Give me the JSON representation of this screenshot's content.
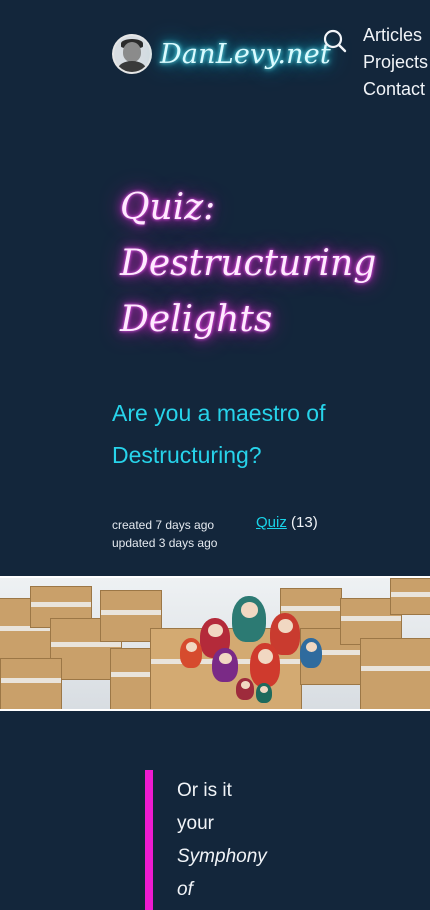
{
  "header": {
    "logo": "DanLevy.net",
    "nav": [
      "Articles",
      "Projects",
      "Contact"
    ]
  },
  "article": {
    "title": "Quiz: Destructuring Delights",
    "subtitle": "Are you a maestro of Destructuring?",
    "created": "created 7 days ago",
    "updated": "updated 3 days ago",
    "tag_label": "Quiz",
    "tag_count": "(13)"
  },
  "quote": {
    "line1": "Or is it",
    "line2": "your",
    "line3": "Symphony",
    "line4": "of"
  },
  "colors": {
    "background": "#13263b",
    "accent_cyan": "#27d3ea",
    "accent_magenta": "#ee1bd0"
  },
  "icons": {
    "search": "search-icon"
  }
}
